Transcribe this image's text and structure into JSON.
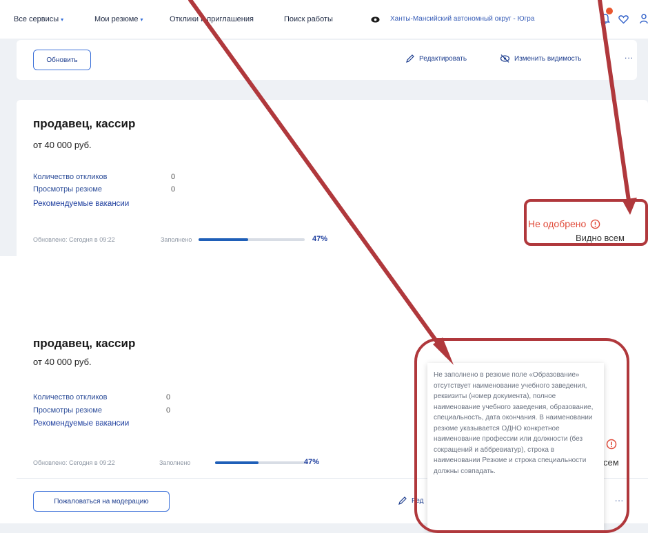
{
  "header": {
    "nav": [
      {
        "label": "Все сервисы",
        "caret": "▾"
      },
      {
        "label": "Мои резюме",
        "caret": "▾"
      },
      {
        "label": "Отклики и приглашения"
      },
      {
        "label": "Поиск работы"
      }
    ],
    "region": "Ханты-Мансийский автономный округ - Югра",
    "icons": [
      "eye-icon",
      "bell-icon",
      "heart-icon",
      "user-icon"
    ]
  },
  "top_card": {
    "refresh_button": "Обновить",
    "edit_label": "Редактировать",
    "visibility_label": "Изменить видимость",
    "more": "..."
  },
  "resume1": {
    "title": "продавец, кассир",
    "salary": "от 40 000 руб.",
    "responses_label": "Количество откликов",
    "responses_value": "0",
    "views_label": "Просмотры резюме",
    "views_value": "0",
    "recommended": "Рекомендуемые вакансии",
    "updated": "Обновлено: Сегодня в 09:22",
    "filled_label": "Заполнено",
    "filled_percent": "47%",
    "filled_fraction": 0.47,
    "status": "Не одобрено",
    "visibility": "Видно всем"
  },
  "resume2": {
    "title": "продавец, кассир",
    "salary": "от 40 000 руб.",
    "responses_label": "Количество откликов",
    "responses_value": "0",
    "views_label": "Просмотры резюме",
    "views_value": "0",
    "recommended": "Рекомендуемые вакансии",
    "updated": "Обновлено: Сегодня в 09:22",
    "filled_label": "Заполнено",
    "filled_percent": "47%",
    "filled_fraction": 0.47,
    "visibility_partial": "сем",
    "complain_button": "Пожаловаться на модерацию",
    "edit_partial": "Ред",
    "more": "..."
  },
  "tooltip": {
    "text": "Не заполнено в резюме поле «Образование» отсутствует наименование учебного заведения, реквизиты (номер документа), полное наименование учебного заведения, образование, специальность, дата окончания. В наименовании резюме указывается ОДНО конкретное наименование профессии или должности (без сокращений и аббревиатур), строка в наименовании Резюме и строка специальности должны совпадать."
  },
  "colors": {
    "accent": "#1f5fb8",
    "status_red": "#e04b3a",
    "annotation": "#b0383c",
    "band": "#eef1f5"
  }
}
